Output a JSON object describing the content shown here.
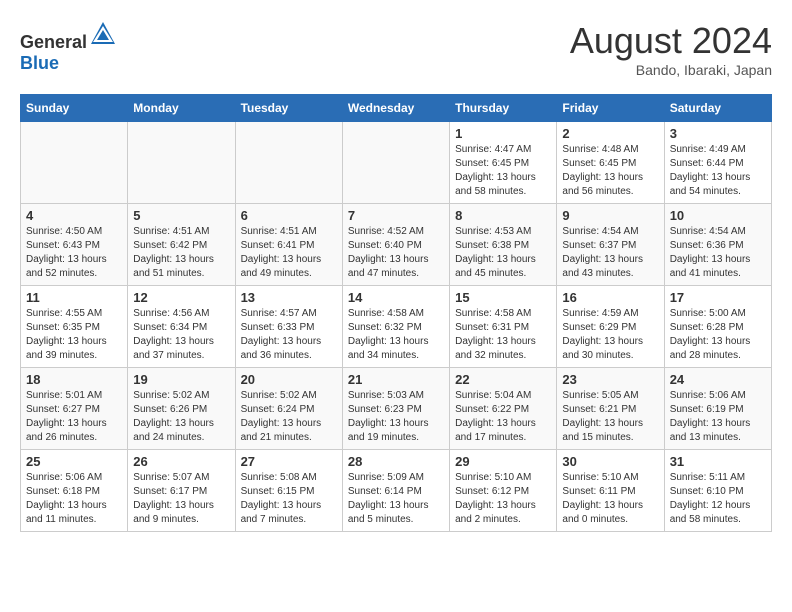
{
  "header": {
    "logo_general": "General",
    "logo_blue": "Blue",
    "month_year": "August 2024",
    "location": "Bando, Ibaraki, Japan"
  },
  "weekdays": [
    "Sunday",
    "Monday",
    "Tuesday",
    "Wednesday",
    "Thursday",
    "Friday",
    "Saturday"
  ],
  "weeks": [
    [
      {
        "day": "",
        "detail": ""
      },
      {
        "day": "",
        "detail": ""
      },
      {
        "day": "",
        "detail": ""
      },
      {
        "day": "",
        "detail": ""
      },
      {
        "day": "1",
        "detail": "Sunrise: 4:47 AM\nSunset: 6:45 PM\nDaylight: 13 hours\nand 58 minutes."
      },
      {
        "day": "2",
        "detail": "Sunrise: 4:48 AM\nSunset: 6:45 PM\nDaylight: 13 hours\nand 56 minutes."
      },
      {
        "day": "3",
        "detail": "Sunrise: 4:49 AM\nSunset: 6:44 PM\nDaylight: 13 hours\nand 54 minutes."
      }
    ],
    [
      {
        "day": "4",
        "detail": "Sunrise: 4:50 AM\nSunset: 6:43 PM\nDaylight: 13 hours\nand 52 minutes."
      },
      {
        "day": "5",
        "detail": "Sunrise: 4:51 AM\nSunset: 6:42 PM\nDaylight: 13 hours\nand 51 minutes."
      },
      {
        "day": "6",
        "detail": "Sunrise: 4:51 AM\nSunset: 6:41 PM\nDaylight: 13 hours\nand 49 minutes."
      },
      {
        "day": "7",
        "detail": "Sunrise: 4:52 AM\nSunset: 6:40 PM\nDaylight: 13 hours\nand 47 minutes."
      },
      {
        "day": "8",
        "detail": "Sunrise: 4:53 AM\nSunset: 6:38 PM\nDaylight: 13 hours\nand 45 minutes."
      },
      {
        "day": "9",
        "detail": "Sunrise: 4:54 AM\nSunset: 6:37 PM\nDaylight: 13 hours\nand 43 minutes."
      },
      {
        "day": "10",
        "detail": "Sunrise: 4:54 AM\nSunset: 6:36 PM\nDaylight: 13 hours\nand 41 minutes."
      }
    ],
    [
      {
        "day": "11",
        "detail": "Sunrise: 4:55 AM\nSunset: 6:35 PM\nDaylight: 13 hours\nand 39 minutes."
      },
      {
        "day": "12",
        "detail": "Sunrise: 4:56 AM\nSunset: 6:34 PM\nDaylight: 13 hours\nand 37 minutes."
      },
      {
        "day": "13",
        "detail": "Sunrise: 4:57 AM\nSunset: 6:33 PM\nDaylight: 13 hours\nand 36 minutes."
      },
      {
        "day": "14",
        "detail": "Sunrise: 4:58 AM\nSunset: 6:32 PM\nDaylight: 13 hours\nand 34 minutes."
      },
      {
        "day": "15",
        "detail": "Sunrise: 4:58 AM\nSunset: 6:31 PM\nDaylight: 13 hours\nand 32 minutes."
      },
      {
        "day": "16",
        "detail": "Sunrise: 4:59 AM\nSunset: 6:29 PM\nDaylight: 13 hours\nand 30 minutes."
      },
      {
        "day": "17",
        "detail": "Sunrise: 5:00 AM\nSunset: 6:28 PM\nDaylight: 13 hours\nand 28 minutes."
      }
    ],
    [
      {
        "day": "18",
        "detail": "Sunrise: 5:01 AM\nSunset: 6:27 PM\nDaylight: 13 hours\nand 26 minutes."
      },
      {
        "day": "19",
        "detail": "Sunrise: 5:02 AM\nSunset: 6:26 PM\nDaylight: 13 hours\nand 24 minutes."
      },
      {
        "day": "20",
        "detail": "Sunrise: 5:02 AM\nSunset: 6:24 PM\nDaylight: 13 hours\nand 21 minutes."
      },
      {
        "day": "21",
        "detail": "Sunrise: 5:03 AM\nSunset: 6:23 PM\nDaylight: 13 hours\nand 19 minutes."
      },
      {
        "day": "22",
        "detail": "Sunrise: 5:04 AM\nSunset: 6:22 PM\nDaylight: 13 hours\nand 17 minutes."
      },
      {
        "day": "23",
        "detail": "Sunrise: 5:05 AM\nSunset: 6:21 PM\nDaylight: 13 hours\nand 15 minutes."
      },
      {
        "day": "24",
        "detail": "Sunrise: 5:06 AM\nSunset: 6:19 PM\nDaylight: 13 hours\nand 13 minutes."
      }
    ],
    [
      {
        "day": "25",
        "detail": "Sunrise: 5:06 AM\nSunset: 6:18 PM\nDaylight: 13 hours\nand 11 minutes."
      },
      {
        "day": "26",
        "detail": "Sunrise: 5:07 AM\nSunset: 6:17 PM\nDaylight: 13 hours\nand 9 minutes."
      },
      {
        "day": "27",
        "detail": "Sunrise: 5:08 AM\nSunset: 6:15 PM\nDaylight: 13 hours\nand 7 minutes."
      },
      {
        "day": "28",
        "detail": "Sunrise: 5:09 AM\nSunset: 6:14 PM\nDaylight: 13 hours\nand 5 minutes."
      },
      {
        "day": "29",
        "detail": "Sunrise: 5:10 AM\nSunset: 6:12 PM\nDaylight: 13 hours\nand 2 minutes."
      },
      {
        "day": "30",
        "detail": "Sunrise: 5:10 AM\nSunset: 6:11 PM\nDaylight: 13 hours\nand 0 minutes."
      },
      {
        "day": "31",
        "detail": "Sunrise: 5:11 AM\nSunset: 6:10 PM\nDaylight: 12 hours\nand 58 minutes."
      }
    ]
  ]
}
